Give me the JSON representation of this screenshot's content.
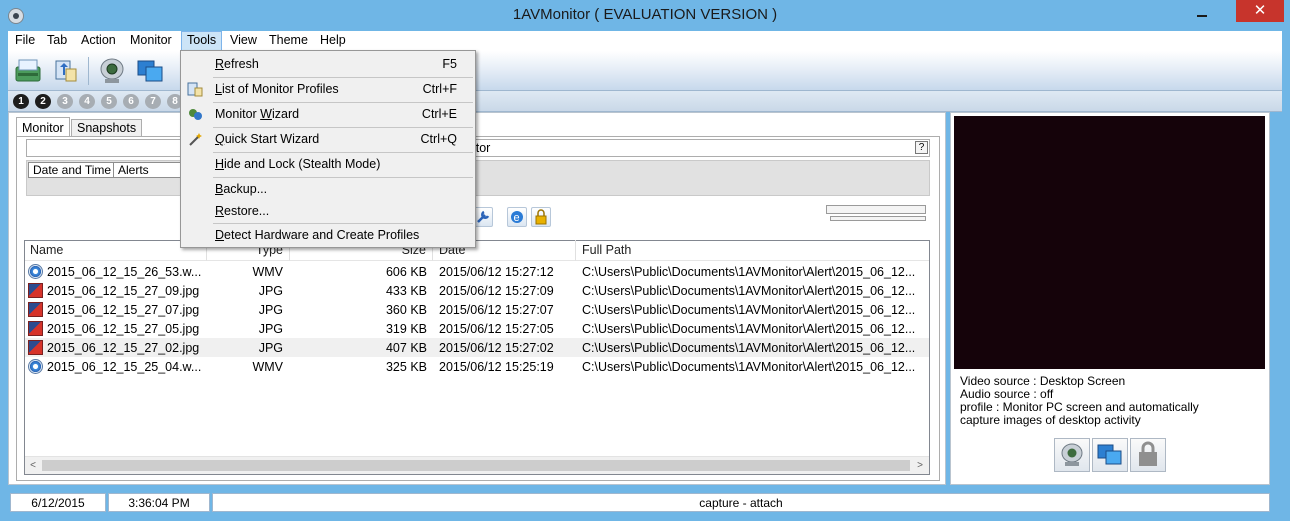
{
  "window": {
    "title": "1AVMonitor ( EVALUATION VERSION )",
    "close_glyph": "✕"
  },
  "menubar": {
    "items": [
      "File",
      "Tab",
      "Action",
      "Monitor",
      "Tools",
      "View",
      "Theme",
      "Help"
    ],
    "active": "Tools"
  },
  "tab_numbers": [
    "1",
    "2",
    "3",
    "4",
    "5",
    "6",
    "7",
    "8"
  ],
  "tabs": {
    "monitor": "Monitor",
    "snapshots": "Snapshots"
  },
  "monitor_header": {
    "title_fragment": "nitor",
    "help": "?"
  },
  "alerts_table": {
    "headers": [
      "Date and Time",
      "Alerts"
    ]
  },
  "file_list": {
    "columns": [
      "Name",
      "Type",
      "Size",
      "Date",
      "Full Path"
    ],
    "rows": [
      {
        "name": "2015_06_12_15_26_53.w...",
        "type": "WMV",
        "size": "606 KB",
        "date": "2015/06/12 15:27:12",
        "path": "C:\\Users\\Public\\Documents\\1AVMonitor\\Alert\\2015_06_12...",
        "icon": "video-file-icon"
      },
      {
        "name": "2015_06_12_15_27_09.jpg",
        "type": "JPG",
        "size": "433 KB",
        "date": "2015/06/12 15:27:09",
        "path": "C:\\Users\\Public\\Documents\\1AVMonitor\\Alert\\2015_06_12...",
        "icon": "image-file-icon"
      },
      {
        "name": "2015_06_12_15_27_07.jpg",
        "type": "JPG",
        "size": "360 KB",
        "date": "2015/06/12 15:27:07",
        "path": "C:\\Users\\Public\\Documents\\1AVMonitor\\Alert\\2015_06_12...",
        "icon": "image-file-icon"
      },
      {
        "name": "2015_06_12_15_27_05.jpg",
        "type": "JPG",
        "size": "319 KB",
        "date": "2015/06/12 15:27:05",
        "path": "C:\\Users\\Public\\Documents\\1AVMonitor\\Alert\\2015_06_12...",
        "icon": "image-file-icon"
      },
      {
        "name": "2015_06_12_15_27_02.jpg",
        "type": "JPG",
        "size": "407 KB",
        "date": "2015/06/12 15:27:02",
        "path": "C:\\Users\\Public\\Documents\\1AVMonitor\\Alert\\2015_06_12...",
        "icon": "image-file-icon"
      },
      {
        "name": "2015_06_12_15_25_04.w...",
        "type": "WMV",
        "size": "325 KB",
        "date": "2015/06/12 15:25:19",
        "path": "C:\\Users\\Public\\Documents\\1AVMonitor\\Alert\\2015_06_12...",
        "icon": "video-file-icon"
      }
    ],
    "scroll_left": "<",
    "scroll_right": ">"
  },
  "source_info": {
    "video": "Video source : Desktop Screen",
    "audio": "Audio source : off",
    "profile_line1": "profile : Monitor PC screen and automatically",
    "profile_line2": "capture images of desktop activity"
  },
  "status": {
    "date": "6/12/2015",
    "time": "3:36:04 PM",
    "message": "capture - attach"
  },
  "tools_menu": {
    "refresh": {
      "pre": "",
      "u": "R",
      "post": "efresh",
      "shortcut": "F5"
    },
    "profiles": {
      "pre": "",
      "u": "L",
      "post": "ist of Monitor Profiles",
      "shortcut": "Ctrl+F"
    },
    "wizard": {
      "pre": "Monitor ",
      "u": "W",
      "post": "izard",
      "shortcut": "Ctrl+E"
    },
    "quickstart": {
      "pre": "",
      "u": "Q",
      "post": "uick Start Wizard",
      "shortcut": "Ctrl+Q"
    },
    "hide": {
      "pre": "",
      "u": "H",
      "post": "ide and Lock (Stealth Mode)",
      "shortcut": ""
    },
    "backup": {
      "pre": "",
      "u": "B",
      "post": "ackup...",
      "shortcut": ""
    },
    "restore": {
      "pre": "",
      "u": "R",
      "post": "estore...",
      "shortcut": ""
    },
    "detect": {
      "pre": "",
      "u": "D",
      "post": "etect Hardware and Create Profiles",
      "shortcut": ""
    }
  },
  "colors": {
    "accent": "#6fb6e6",
    "close": "#c7342c",
    "preview": "#15030a"
  }
}
